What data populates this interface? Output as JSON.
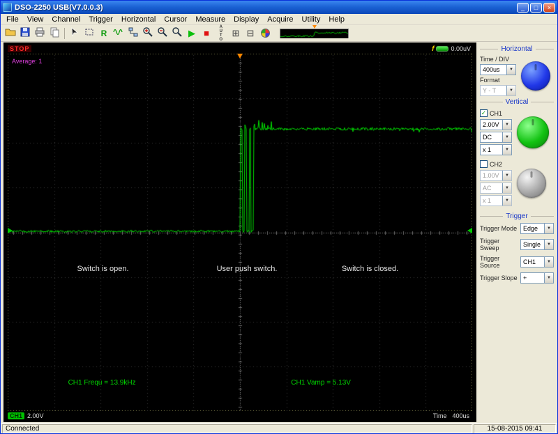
{
  "window": {
    "title": "DSO-2250 USB(V7.0.0.3)",
    "controls": {
      "minimize": "_",
      "maximize": "□",
      "close": "×"
    }
  },
  "menu": {
    "items": [
      "File",
      "View",
      "Channel",
      "Trigger",
      "Horizontal",
      "Cursor",
      "Measure",
      "Display",
      "Acquire",
      "Utility",
      "Help"
    ]
  },
  "toolbar": {
    "refresh_label": "R",
    "run_glyph": "▶",
    "stop_glyph": "■",
    "auto_label": "AUTO",
    "grid_glyph": "⊞",
    "split_glyph": "⊟",
    "icons": [
      "open-icon",
      "save-icon",
      "print-icon",
      "copy-icon",
      "cursor-icon",
      "select-region-icon",
      "refresh-icon",
      "waveform-icon",
      "network-icon",
      "zoom-in-icon",
      "zoom-out-icon",
      "zoom-window-icon",
      "run-icon",
      "stop-icon",
      "auto-setup-icon",
      "grid-icon",
      "split-grid-icon",
      "palette-icon",
      "waveform-preview"
    ]
  },
  "scope": {
    "run_state": "STOP",
    "average_label": "Average: 1",
    "voltage_readout": "0.00uV",
    "annotations": [
      "Switch is open.",
      "User push switch.",
      "Switch is closed."
    ],
    "measurements": {
      "freq": "CH1 Frequ = 13.9kHz",
      "vamp": "CH1 Vamp = 5.13V"
    },
    "ch_badge": {
      "ch": "CH1",
      "volts": "2.00V"
    },
    "time_badge": {
      "label": "Time",
      "value": "400us"
    }
  },
  "sidebar": {
    "horizontal": {
      "title": "Horizontal",
      "time_div_label": "Time / DIV",
      "time_div_value": "400us",
      "format_label": "Format",
      "format_value": "Y - T"
    },
    "vertical": {
      "title": "Vertical",
      "ch1": {
        "label": "CH1",
        "check": "✓",
        "volt": "2.00V",
        "coupling": "DC",
        "probe": "x 1"
      },
      "ch2": {
        "label": "CH2",
        "check": "",
        "volt": "1.00V",
        "coupling": "AC",
        "probe": "x 1"
      }
    },
    "trigger": {
      "title": "Trigger",
      "rows": [
        {
          "label": "Trigger Mode",
          "value": "Edge"
        },
        {
          "label": "Trigger Sweep",
          "value": "Single"
        },
        {
          "label": "Trigger Source",
          "value": "CH1"
        },
        {
          "label": "Trigger Slope",
          "value": "+"
        }
      ]
    }
  },
  "statusbar": {
    "left": "Connected",
    "right": "15-08-2015 09:41"
  },
  "colors": {
    "waveform": "#00dd00",
    "trigger_marker": "#ff8800",
    "channel_marker": "#00cc00",
    "average_text": "#e040e0",
    "stop_text": "#ff2a2a"
  }
}
